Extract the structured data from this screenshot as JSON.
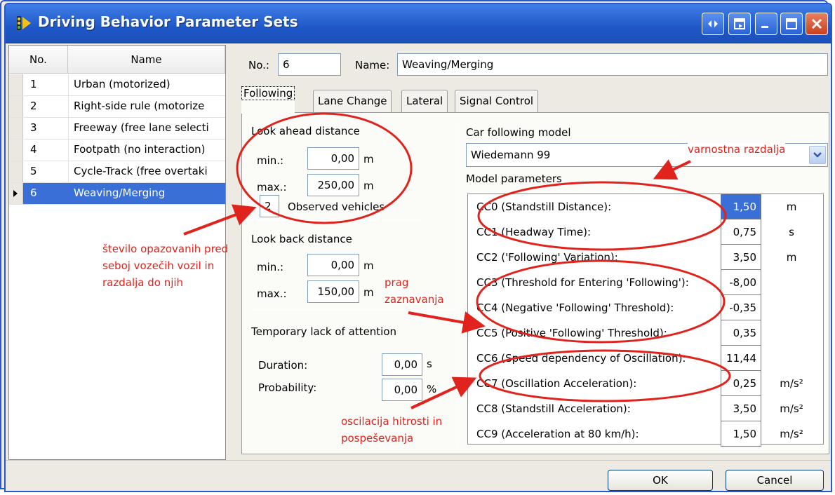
{
  "window": {
    "title": "Driving Behavior Parameter Sets"
  },
  "list": {
    "headers": {
      "no": "No.",
      "name": "Name"
    },
    "rows": [
      {
        "no": "1",
        "name": "Urban (motorized)"
      },
      {
        "no": "2",
        "name": "Right-side rule (motorize"
      },
      {
        "no": "3",
        "name": "Freeway (free lane selecti"
      },
      {
        "no": "4",
        "name": "Footpath (no interaction)"
      },
      {
        "no": "5",
        "name": "Cycle-Track (free overtaki"
      },
      {
        "no": "6",
        "name": "Weaving/Merging"
      }
    ]
  },
  "form": {
    "no_label": "No.:",
    "no_value": "6",
    "name_label": "Name:",
    "name_value": "Weaving/Merging"
  },
  "tabs": [
    "Following",
    "Lane Change",
    "Lateral",
    "Signal Control"
  ],
  "following": {
    "look_ahead": {
      "title": "Look ahead distance",
      "min_label": "min.:",
      "min_value": "0,00",
      "max_label": "max.:",
      "max_value": "250,00",
      "unit": "m",
      "observed_value": "2",
      "observed_label": "Observed vehicles"
    },
    "look_back": {
      "title": "Look back distance",
      "min_label": "min.:",
      "min_value": "0,00",
      "max_label": "max.:",
      "max_value": "150,00",
      "unit": "m"
    },
    "attention": {
      "title": "Temporary lack of attention",
      "duration_label": "Duration:",
      "duration_value": "0,00",
      "duration_unit": "s",
      "probability_label": "Probability:",
      "probability_value": "0,00",
      "probability_unit": "%"
    },
    "car_following": {
      "title": "Car following model",
      "model": "Wiedemann 99",
      "params_title": "Model parameters",
      "params": [
        {
          "name": "CC0 (Standstill Distance):",
          "value": "1,50",
          "unit": "m"
        },
        {
          "name": "CC1 (Headway Time):",
          "value": "0,75",
          "unit": "s"
        },
        {
          "name": "CC2 ('Following' Variation):",
          "value": "3,50",
          "unit": "m"
        },
        {
          "name": "CC3 (Threshold for Entering 'Following'):",
          "value": "-8,00",
          "unit": ""
        },
        {
          "name": "CC4 (Negative 'Following' Threshold):",
          "value": "-0,35",
          "unit": ""
        },
        {
          "name": "CC5 (Positive 'Following' Threshold):",
          "value": "0,35",
          "unit": ""
        },
        {
          "name": "CC6 (Speed dependency of Oscillation):",
          "value": "11,44",
          "unit": ""
        },
        {
          "name": "CC7 (Oscillation Acceleration):",
          "value": "0,25",
          "unit": "m/s²"
        },
        {
          "name": "CC8 (Standstill Acceleration):",
          "value": "3,50",
          "unit": "m/s²"
        },
        {
          "name": "CC9 (Acceleration at 80 km/h):",
          "value": "1,50",
          "unit": "m/s²"
        }
      ]
    }
  },
  "buttons": {
    "ok": "OK",
    "cancel": "Cancel"
  },
  "annotations": {
    "vehicles_1": "število opazovanih pred",
    "vehicles_2": "seboj vozečih vozil  in",
    "vehicles_3": "razdalja do njih",
    "threshold_1": "prag",
    "threshold_2": "zaznavanja",
    "oscillation_1": "oscilacija hitrosti in",
    "oscillation_2": "pospeševanja",
    "safety": "varnostna razdalja"
  },
  "colors": {
    "title_bar": "#1f57c8",
    "selection": "#3a6fd8",
    "annotation": "#e0231c"
  }
}
